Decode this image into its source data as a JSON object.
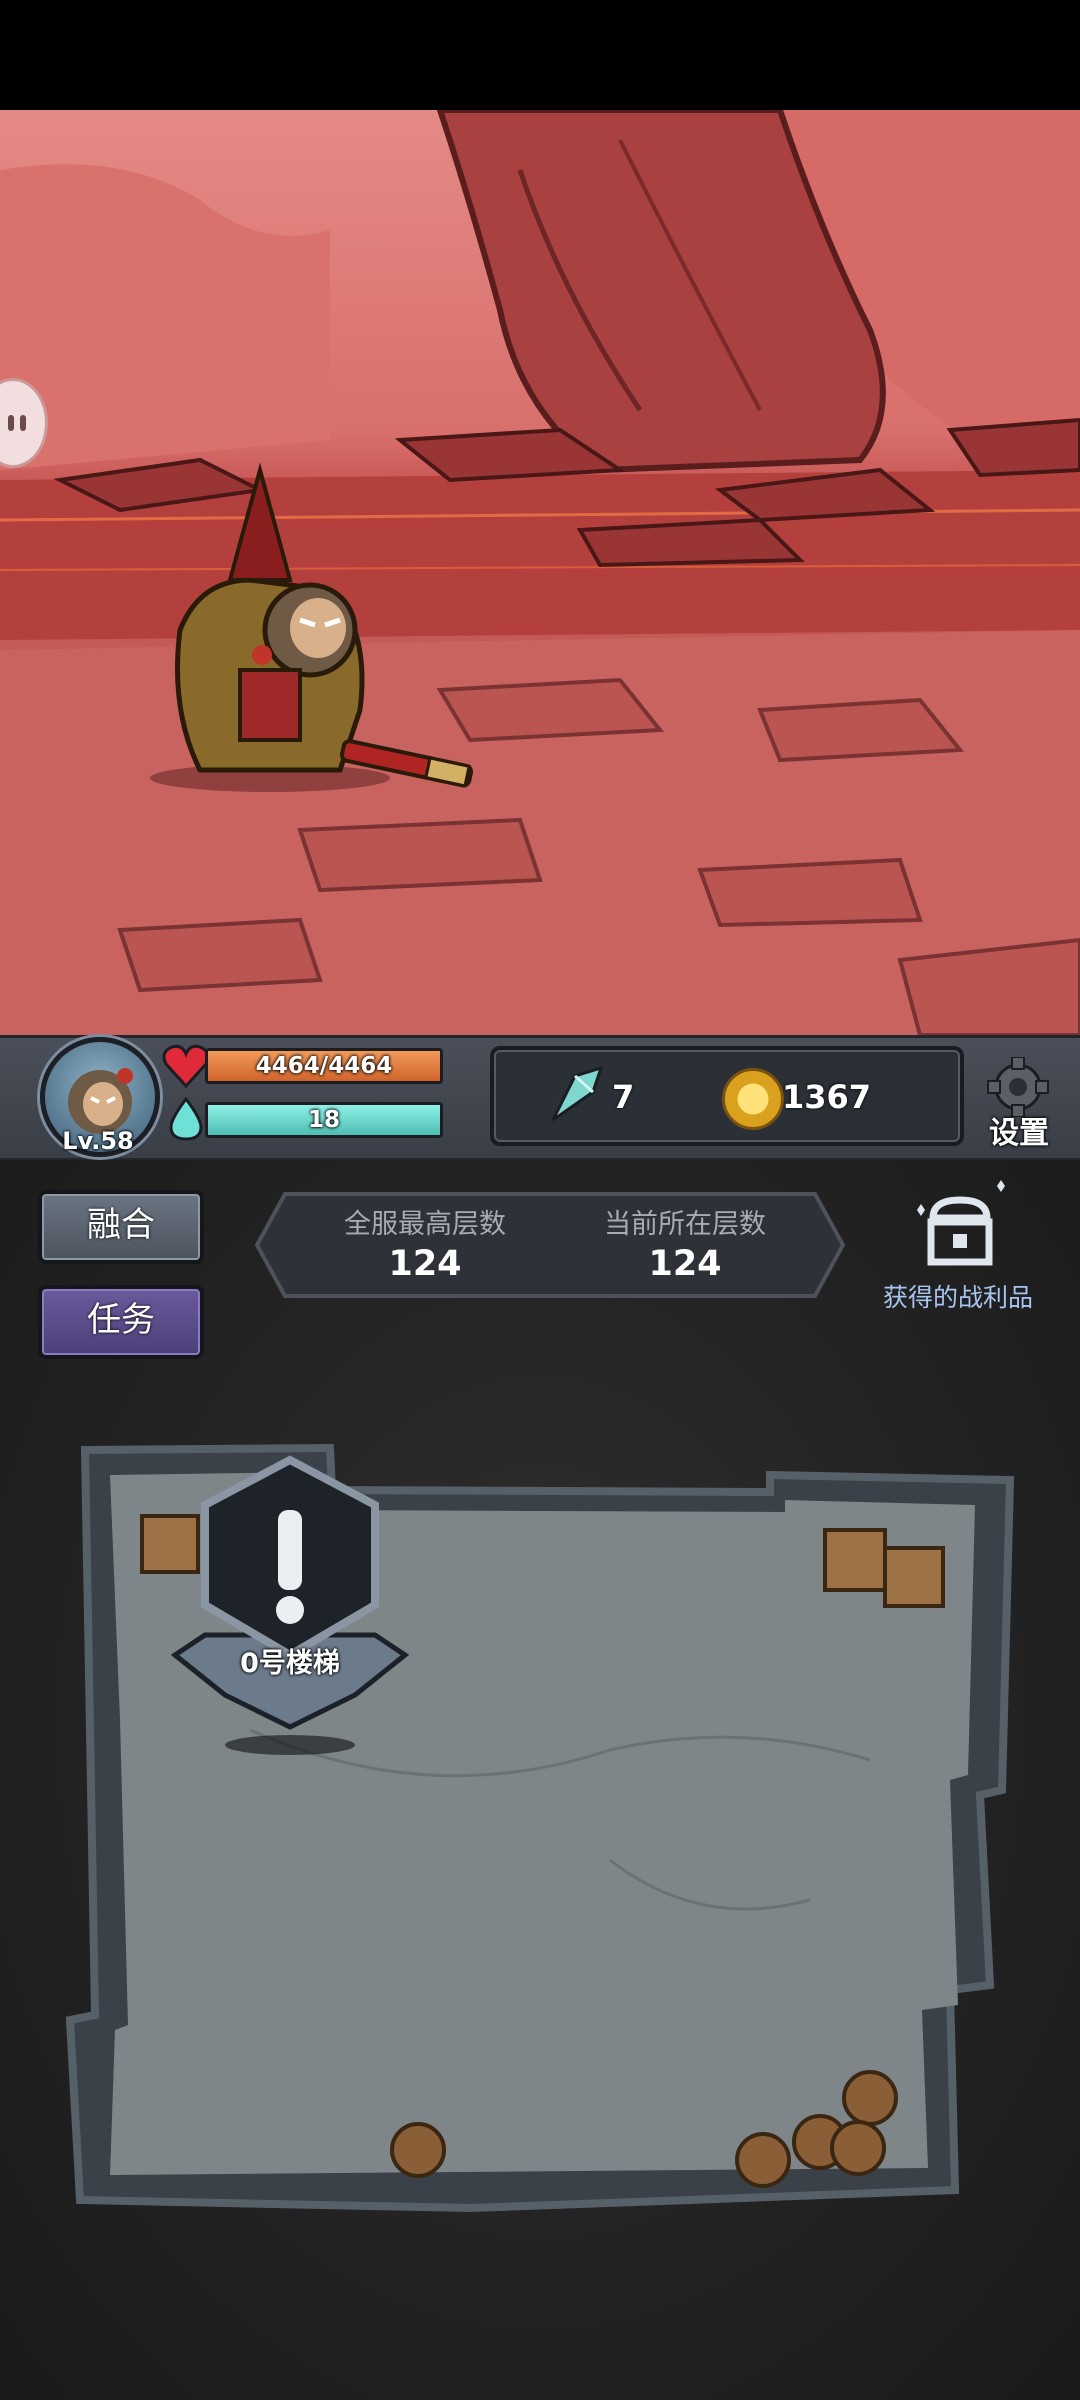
{
  "player": {
    "level_label": "Lv.58",
    "hp_text": "4464/4464",
    "hp_fraction": 1.0,
    "mana_text": "18",
    "mana_fraction": 1.0
  },
  "resources": {
    "gems": "7",
    "coins": "1367"
  },
  "settings": {
    "label": "设置"
  },
  "buttons": {
    "fuse": "融合",
    "task": "任务"
  },
  "floors": {
    "server_best_label": "全服最高层数",
    "server_best_value": "124",
    "current_label": "当前所在层数",
    "current_value": "124"
  },
  "loot": {
    "label": "获得的战利品"
  },
  "map": {
    "stair_label": "0号楼梯"
  },
  "colors": {
    "hp_bar": "#e07a3a",
    "mana_bar": "#6fd4cc",
    "task_button": "#5a4a8c",
    "loot_text": "#a8c5f0"
  },
  "icons": [
    "heart-icon",
    "mana-drop-icon",
    "gem-icon",
    "coin-icon",
    "gear-icon",
    "treasure-chest-icon",
    "exclamation-icon"
  ]
}
